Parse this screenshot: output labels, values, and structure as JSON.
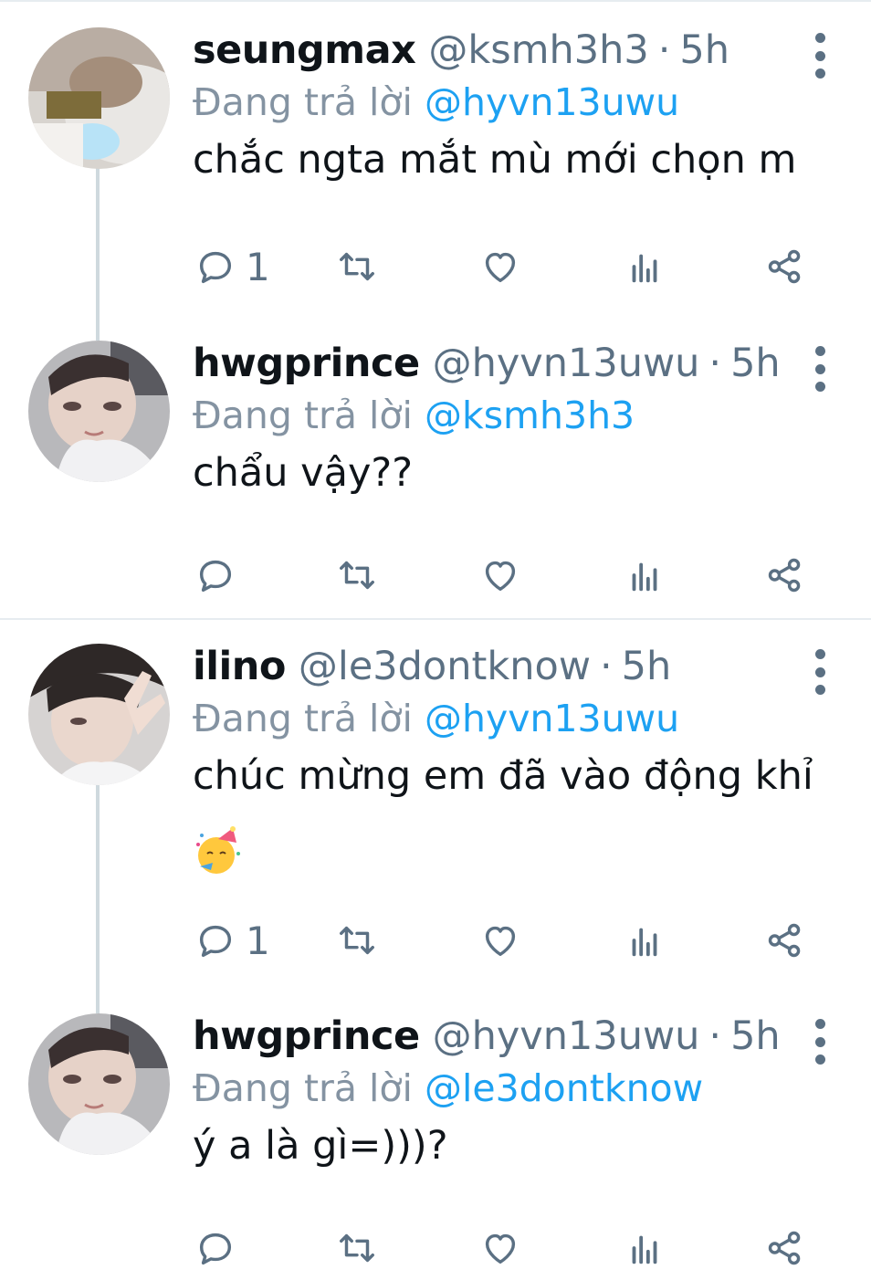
{
  "colors": {
    "link": "#1da1f2",
    "muted": "#5b7083",
    "text": "#0f1419",
    "thread_line": "#cfd9de"
  },
  "tweets": [
    {
      "name": "seungmax",
      "handle": "@ksmh3h3",
      "separator": "·",
      "time": "5h",
      "reply_label": "Đang trả lời",
      "reply_to": "@hyvn13uwu",
      "text": "chắc ngta mắt mù mới chọn m",
      "reply_count": "1",
      "avatar_icon": "avatar-photo"
    },
    {
      "name": "hwgprince",
      "handle": "@hyvn13uwu",
      "separator": "·",
      "time": "5h",
      "reply_label": "Đang trả lời",
      "reply_to": "@ksmh3h3",
      "text": "chẩu vậy??",
      "reply_count": "",
      "avatar_icon": "avatar-photo"
    },
    {
      "name": "ilino",
      "handle": "@le3dontknow",
      "separator": "·",
      "time": "5h",
      "reply_label": "Đang trả lời",
      "reply_to": "@hyvn13uwu",
      "text": "chúc mừng em đã vào động khỉ",
      "emoji": "partying-face-emoji",
      "reply_count": "1",
      "avatar_icon": "avatar-photo"
    },
    {
      "name": "hwgprince",
      "handle": "@hyvn13uwu",
      "separator": "·",
      "time": "5h",
      "reply_label": "Đang trả lời",
      "reply_to": "@le3dontknow",
      "text": "ý a là gì=)))?",
      "reply_count": "",
      "avatar_icon": "avatar-photo"
    }
  ]
}
